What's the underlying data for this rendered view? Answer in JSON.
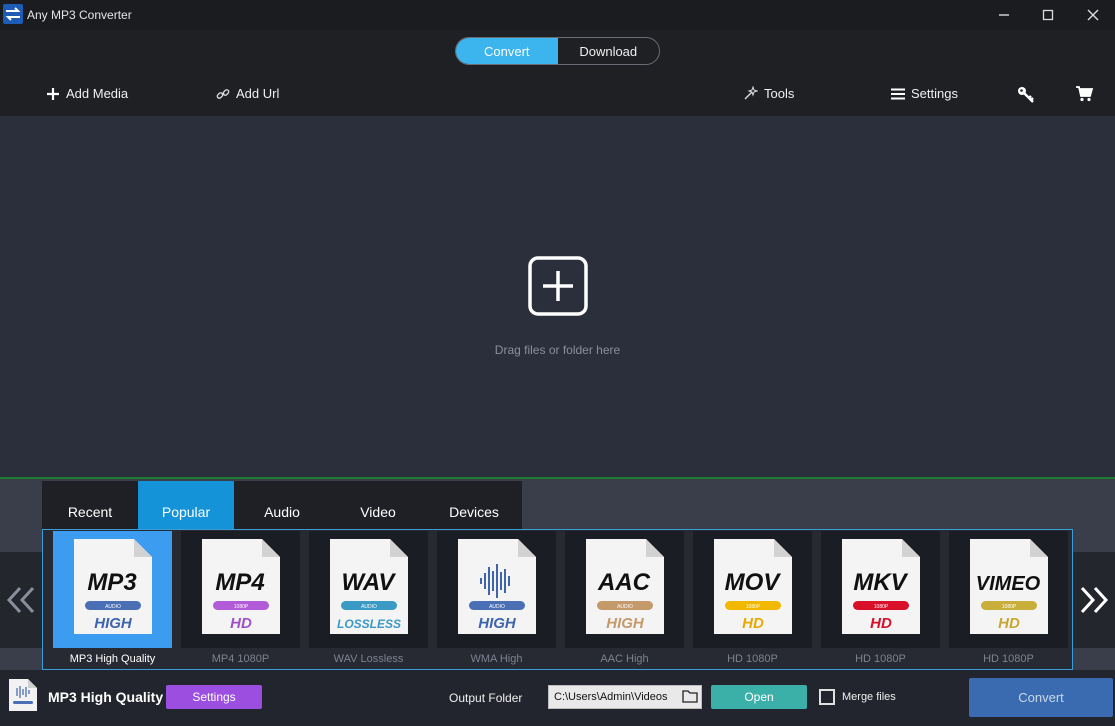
{
  "window": {
    "title": "Any MP3 Converter"
  },
  "header": {
    "modes": [
      "Convert",
      "Download"
    ],
    "active_mode": "Convert",
    "toolbar": {
      "add_media": "Add Media",
      "add_url": "Add Url",
      "tools": "Tools",
      "settings": "Settings"
    }
  },
  "dropzone": {
    "hint": "Drag files or folder here"
  },
  "formats": {
    "tabs": [
      "Recent",
      "Popular",
      "Audio",
      "Video",
      "Devices"
    ],
    "active_tab": "Popular",
    "cards": [
      {
        "name": "MP3",
        "badge": "AUDIO",
        "quality": "HIGH",
        "label": "MP3 High Quality",
        "badge_color": "#4a6fb5",
        "quality_color": "#3e64ae",
        "wave": false
      },
      {
        "name": "MP4",
        "badge": "1080P",
        "quality": "HD",
        "label": "MP4 1080P",
        "badge_color": "#b15bd8",
        "quality_color": "#a050c8",
        "wave": false
      },
      {
        "name": "WAV",
        "badge": "AUDIO",
        "quality": "LOSSLESS",
        "label": "WAV Lossless",
        "badge_color": "#3b9ac4",
        "quality_color": "#3b9ac4",
        "wave": false
      },
      {
        "name": "",
        "badge": "AUDIO",
        "quality": "HIGH",
        "label": "WMA High",
        "badge_color": "#4a6fb5",
        "quality_color": "#3e64ae",
        "wave": true
      },
      {
        "name": "AAC",
        "badge": "AUDIO",
        "quality": "HIGH",
        "label": "AAC High",
        "badge_color": "#c49a6b",
        "quality_color": "#c49a6b",
        "wave": false
      },
      {
        "name": "MOV",
        "badge": "1080P",
        "quality": "HD",
        "label": "HD 1080P",
        "badge_color": "#f2b800",
        "quality_color": "#e8aa00",
        "wave": false
      },
      {
        "name": "MKV",
        "badge": "1080P",
        "quality": "HD",
        "label": "HD 1080P",
        "badge_color": "#d8102a",
        "quality_color": "#d8102a",
        "wave": false
      },
      {
        "name": "VIMEO",
        "badge": "1080P",
        "quality": "HD",
        "label": "HD 1080P",
        "badge_color": "#c8ae3a",
        "quality_color": "#c8a830",
        "wave": false
      }
    ],
    "selected_index": 0
  },
  "bottombar": {
    "selected_format": "MP3 High Quality",
    "settings_label": "Settings",
    "output_folder_label": "Output Folder",
    "output_path": "C:\\Users\\Admin\\Videos",
    "open_label": "Open",
    "merge_label": "Merge files",
    "merge_checked": false,
    "convert_label": "Convert"
  },
  "colors": {
    "accent_blue": "#3cb5ee",
    "tab_active": "#1493d8",
    "settings_purple": "#9b4ee0",
    "open_teal": "#3bb0a8",
    "convert_blue": "#3a6bb0"
  }
}
